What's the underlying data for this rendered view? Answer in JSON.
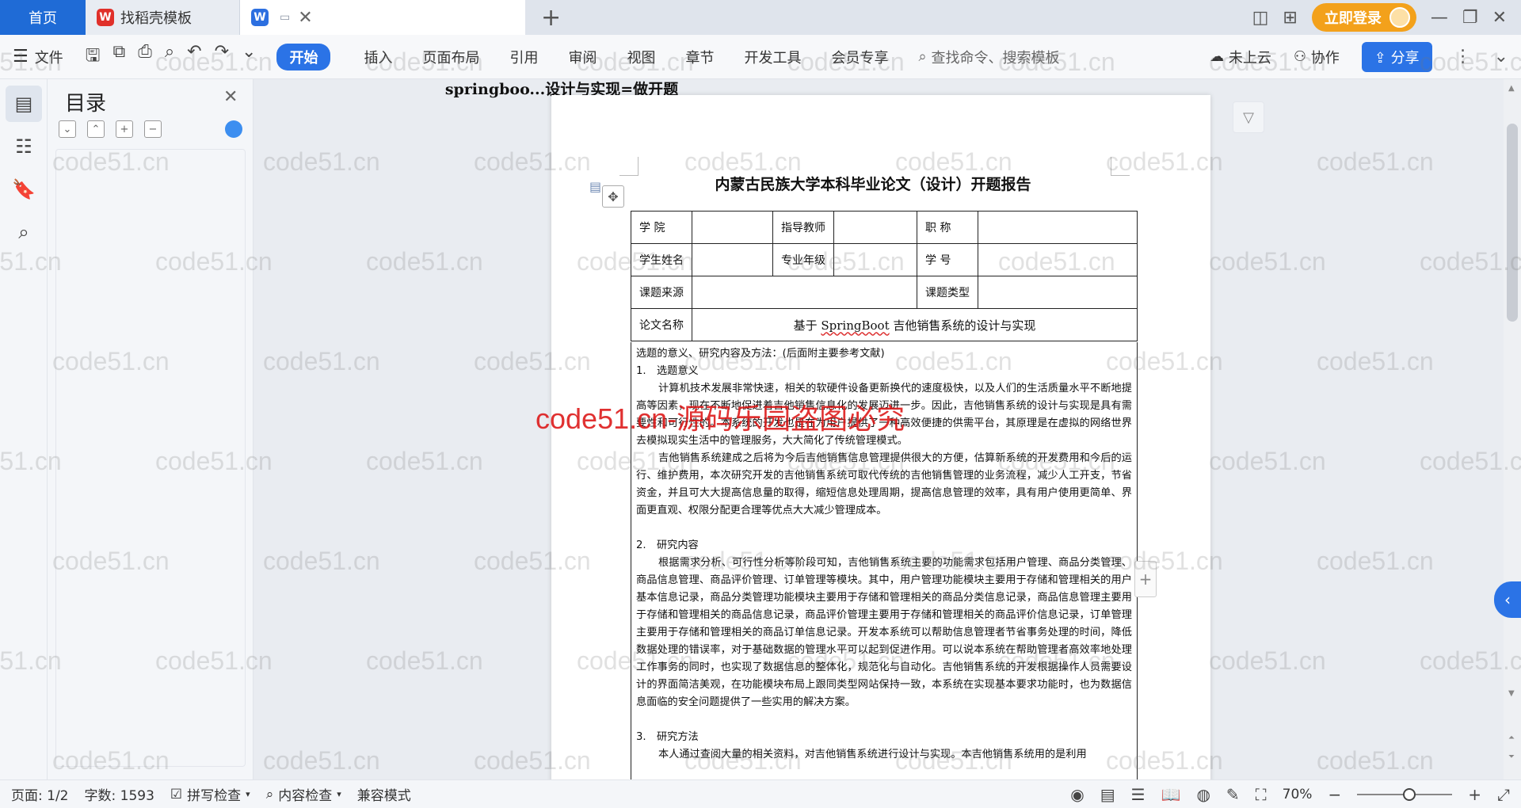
{
  "tabs": {
    "home": "首页",
    "template": "找稻壳模板",
    "document": "springboo...设计与实现=做开题"
  },
  "titlebar": {
    "login": "立即登录"
  },
  "ribbon": {
    "file": "文件",
    "start": "开始",
    "menu": [
      "插入",
      "页面布局",
      "引用",
      "审阅",
      "视图",
      "章节",
      "开发工具",
      "会员专享"
    ],
    "search_placeholder": "查找命令、搜索模板",
    "cloud": "未上云",
    "collab": "协作",
    "share": "分享"
  },
  "toc": {
    "title": "目录"
  },
  "document": {
    "title": "内蒙古民族大学本科毕业论文（设计）开题报告",
    "table": {
      "r1": [
        "学 院",
        "",
        "指导教师",
        "",
        "职 称",
        ""
      ],
      "r2": [
        "学生姓名",
        "",
        "专业年级",
        "",
        "学 号",
        ""
      ],
      "r3": [
        "课题来源",
        "",
        "课题类型",
        ""
      ],
      "r4_label": "论文名称",
      "r4_value_prefix": "基于 ",
      "r4_value_spring": "SpringBoot",
      "r4_value_suffix": " 吉他销售系统的设计与实现"
    },
    "section_intro": "选题的意义、研究内容及方法：(后面附主要参考文献)",
    "h1_num": "1.",
    "h1": "选题意义",
    "p1": "计算机技术发展非常快速，相关的软硬件设备更新换代的速度极快，以及人们的生活质量水平不断地提高等因素，现在不断地促进着吉他销售信息化的发展迈进一步。因此，吉他销售系统的设计与实现是具有需要性和可行性的。本系统的开发也是在为用户提供了一种高效便捷的供需平台，其原理是在虚拟的网络世界去模拟现实生活中的管理服务，大大简化了传统管理模式。",
    "p2": "吉他销售系统建成之后将为今后吉他销售信息管理提供很大的方便，估算新系统的开发费用和今后的运行、维护费用，本次研究开发的吉他销售系统可取代传统的吉他销售管理的业务流程，减少人工开支，节省资金，并且可大大提高信息量的取得，缩短信息处理周期，提高信息管理的效率，具有用户使用更简单、界面更直观、权限分配更合理等优点大大减少管理成本。",
    "h2_num": "2.",
    "h2": "研究内容",
    "p3": "根据需求分析、可行性分析等阶段可知，吉他销售系统主要的功能需求包括用户管理、商品分类管理、商品信息管理、商品评价管理、订单管理等模块。其中，用户管理功能模块主要用于存储和管理相关的用户基本信息记录，商品分类管理功能模块主要用于存储和管理相关的商品分类信息记录，商品信息管理主要用于存储和管理相关的商品信息记录，商品评价管理主要用于存储和管理相关的商品评价信息记录，订单管理主要用于存储和管理相关的商品订单信息记录。开发本系统可以帮助信息管理者节省事务处理的时间，降低数据处理的错误率，对于基础数据的管理水平可以起到促进作用。可以说本系统在帮助管理者高效率地处理工作事务的同时，也实现了数据信息的整体化，规范化与自动化。吉他销售系统的开发根据操作人员需要设计的界面简洁美观，在功能模块布局上跟同类型网站保持一致，本系统在实现基本要求功能时，也为数据信息面临的安全问题提供了一些实用的解决方案。",
    "h3_num": "3.",
    "h3": "研究方法",
    "p4": "本人通过查阅大量的相关资料，对吉他销售系统进行设计与实现。本吉他销售系统用的是利用"
  },
  "status": {
    "page": "页面: 1/2",
    "words": "字数: 1593",
    "spell": "拼写检查",
    "content": "内容检查",
    "compat": "兼容模式",
    "zoom": "70%"
  },
  "watermark": {
    "text": "code51.cn",
    "red": "code51.cn-源码乐园盗图必究"
  },
  "colors": {
    "accent": "#2b73e6",
    "login": "#f3a11b",
    "home_tab": "#1f6bd6",
    "watermark_red": "#dc1414"
  }
}
